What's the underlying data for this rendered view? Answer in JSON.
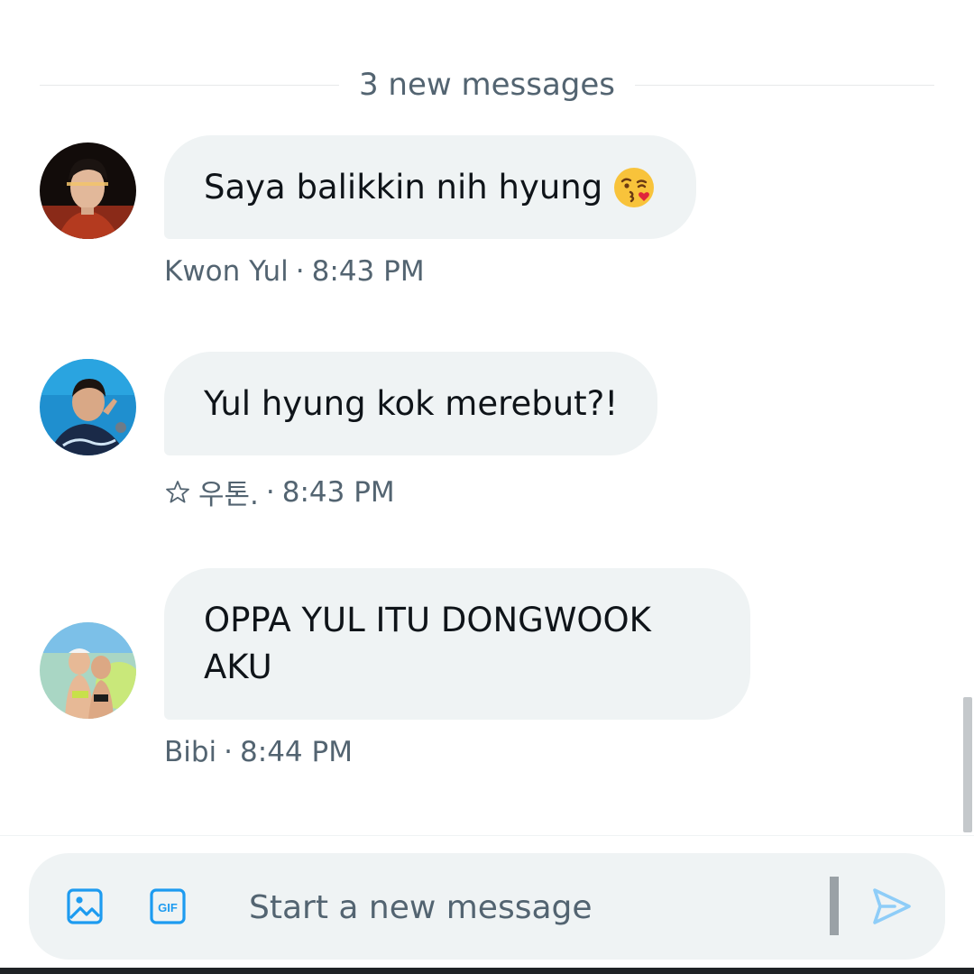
{
  "divider": {
    "label": "3 new messages"
  },
  "messages": [
    {
      "text": "Saya balikkin nih hyung",
      "emoji": "face-blowing-a-kiss",
      "sender": "Kwon Yul",
      "separator": "·",
      "time": "8:43 PM",
      "avatar": "avatar-photo-kwon-yul"
    },
    {
      "text": "Yul hyung kok merebut?!",
      "sender_icon": "star-outline-icon",
      "sender": "우톤.",
      "separator": "·",
      "time": "8:43 PM",
      "avatar": "avatar-photo-user"
    },
    {
      "text": "OPPA YUL ITU DONGWOOK AKU",
      "sender": "Bibi",
      "separator": "·",
      "time": "8:44 PM",
      "avatar": "avatar-photo-bibi"
    }
  ],
  "composer": {
    "placeholder": "Start a new message",
    "media_icon": "image-icon",
    "gif_icon": "gif-icon",
    "send_icon": "send-icon",
    "gif_label": "GIF"
  },
  "colors": {
    "bubble": "#eff3f4",
    "meta_text": "#536471",
    "accent": "#1d9bf0",
    "send_disabled": "#8ecdf8"
  }
}
